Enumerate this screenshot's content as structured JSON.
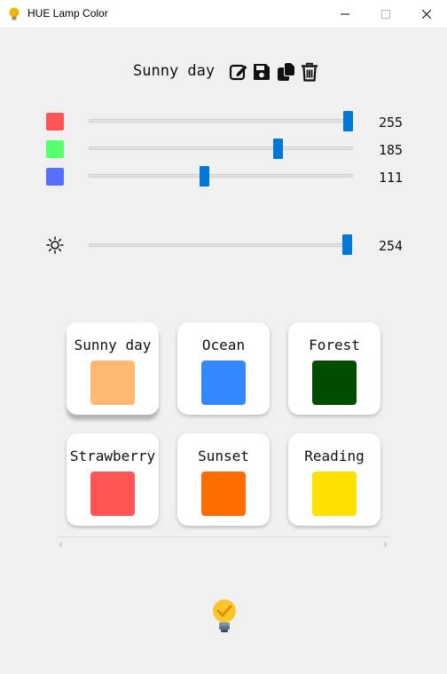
{
  "window": {
    "title": "HUE Lamp Color"
  },
  "preset": {
    "name": "Sunny day"
  },
  "icons": {
    "app": "lightbulb-icon",
    "edit": "edit-icon",
    "save": "save-icon",
    "copy": "copy-icon",
    "delete": "trash-icon",
    "brightness": "sun-icon",
    "lamp": "lightbulb-check-icon"
  },
  "sliders": [
    {
      "name": "red",
      "color": "#ff5555",
      "value": "255",
      "fraction": 1.0
    },
    {
      "name": "green",
      "color": "#55ff6e",
      "value": "185",
      "fraction": 0.7255
    },
    {
      "name": "blue",
      "color": "#5570ff",
      "value": "111",
      "fraction": 0.4353
    }
  ],
  "brightness": {
    "value": "254",
    "fraction": 0.996
  },
  "presets": [
    {
      "label": "Sunny day",
      "color": "#ffb973",
      "active": true
    },
    {
      "label": "Ocean",
      "color": "#3388ff",
      "active": false
    },
    {
      "label": "Forest",
      "color": "#004d00",
      "active": false
    },
    {
      "label": "Strawberry",
      "color": "#ff5555",
      "active": false
    },
    {
      "label": "Sunset",
      "color": "#ff6d00",
      "active": false
    },
    {
      "label": "Reading",
      "color": "#ffe100",
      "active": false
    }
  ]
}
